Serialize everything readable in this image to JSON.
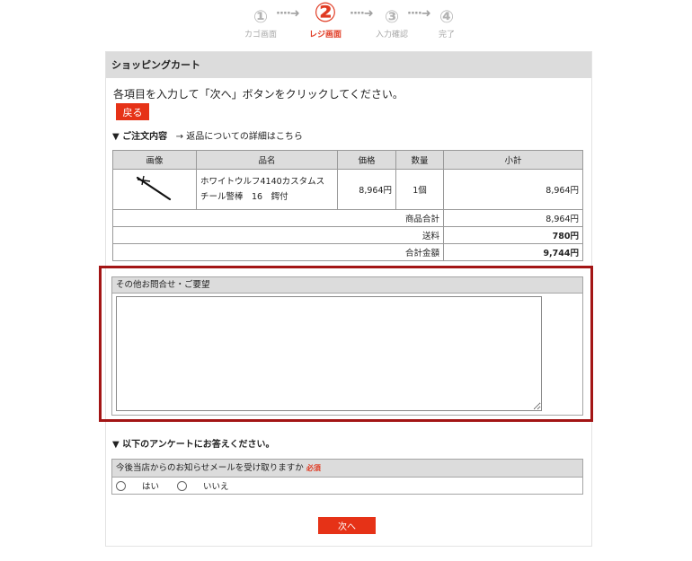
{
  "steps": [
    {
      "num": "①",
      "label": "カゴ画面"
    },
    {
      "num": "②",
      "label": "レジ画面"
    },
    {
      "num": "③",
      "label": "入力確認"
    },
    {
      "num": "④",
      "label": "完了"
    }
  ],
  "step_arrow": "····➜",
  "panel_title": "ショッピングカート",
  "intro_text": "各項目を入力して「次へ」ボタンをクリックしてください。",
  "back_button": "戻る",
  "order_section": {
    "title": "▼ ご注文内容",
    "link": "→ 返品についての詳細はこちら"
  },
  "table": {
    "headers": [
      "画像",
      "品名",
      "価格",
      "数量",
      "小計"
    ],
    "item": {
      "name_line1": "ホワイトウルフ4140カスタムス",
      "name_line2": "チール警棒　16　鍔付",
      "price": "8,964円",
      "qty": "1個",
      "subtotal": "8,964円"
    },
    "summary": [
      {
        "label": "商品合計",
        "value": "8,964円"
      },
      {
        "label": "送料",
        "value": "780円"
      },
      {
        "label": "合計金額",
        "value": "9,744円"
      }
    ]
  },
  "inquiry": {
    "label": "その他お問合せ・ご要望",
    "value": ""
  },
  "survey": {
    "title": "▼ 以下のアンケートにお答えください。",
    "question": "今後当店からのお知らせメールを受け取りますか",
    "required": "必須",
    "options": [
      "はい",
      "いいえ"
    ]
  },
  "next_button": "次へ",
  "colors": {
    "accent": "#e63217",
    "highlight_border": "#a31515"
  }
}
